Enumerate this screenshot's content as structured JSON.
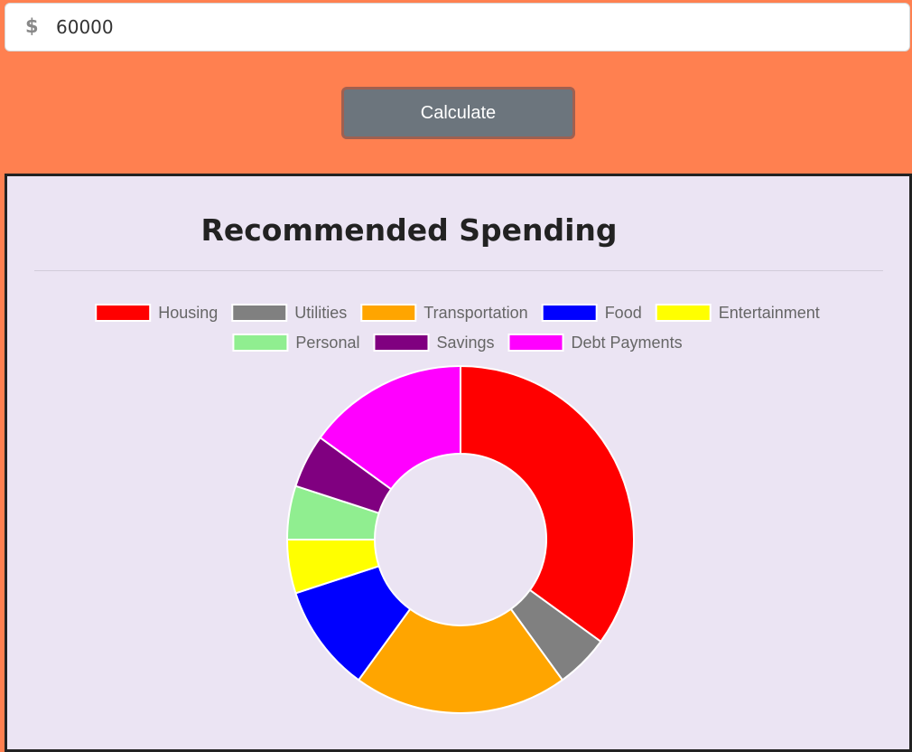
{
  "income": {
    "currency_symbol": "$",
    "value": "60000"
  },
  "calculate_button": {
    "label": "Calculate"
  },
  "results": {
    "title": "Recommended Spending"
  },
  "chart_data": {
    "type": "doughnut",
    "legend_position": "top",
    "categories": [
      "Housing",
      "Utilities",
      "Transportation",
      "Food",
      "Entertainment",
      "Personal",
      "Savings",
      "Debt Payments"
    ],
    "values": [
      35,
      5,
      20,
      10,
      5,
      5,
      5,
      15
    ],
    "colors": [
      "#ff0000",
      "#808080",
      "#ffa500",
      "#0000ff",
      "#ffff00",
      "#90ee90",
      "#800080",
      "#ff00ff"
    ]
  }
}
